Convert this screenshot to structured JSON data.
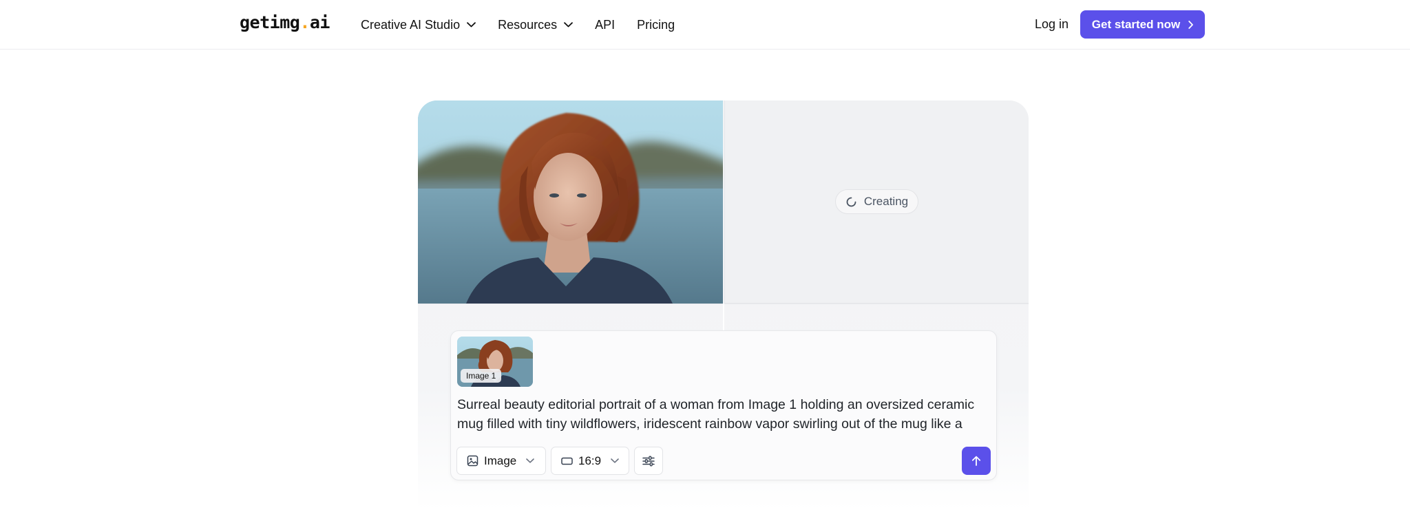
{
  "nav": {
    "logo_main": "getimg",
    "logo_dot": ".",
    "logo_tld": "ai",
    "links": [
      {
        "label": "Creative AI Studio",
        "has_dropdown": true
      },
      {
        "label": "Resources",
        "has_dropdown": true
      },
      {
        "label": "API",
        "has_dropdown": false
      },
      {
        "label": "Pricing",
        "has_dropdown": false
      }
    ],
    "login_label": "Log in",
    "cta_label": "Get started now"
  },
  "gallery": {
    "creating_label": "Creating"
  },
  "prompt": {
    "attachment_label": "Image 1",
    "text": "Surreal beauty editorial portrait of a woman from Image 1 holding an oversized ceramic mug filled with tiny wildflowers, iridescent rainbow vapor swirling out of the mug like a",
    "mode_label": "Image",
    "ratio_label": "16:9"
  },
  "colors": {
    "accent": "#5b50ea",
    "logo_dot": "#f5a623"
  },
  "icons": {
    "dropdown": "chevron-down-icon",
    "cta": "chevron-right-icon",
    "spinner": "spinner-icon",
    "mode": "image-icon",
    "ratio": "aspect-ratio-icon",
    "settings": "sliders-icon",
    "send": "arrow-up-icon"
  }
}
